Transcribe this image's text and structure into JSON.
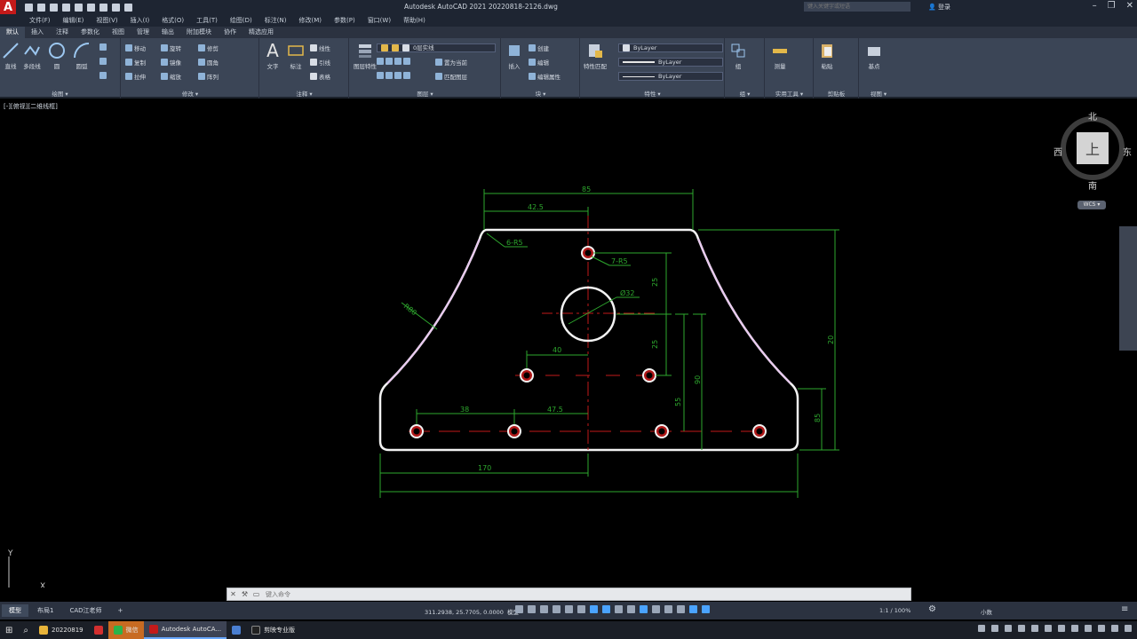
{
  "title_bar": {
    "logo": "A",
    "window_title": "Autodesk AutoCAD 2021    20220818-2126.dwg",
    "search_placeholder": "键入关键字或短语",
    "login": "登录"
  },
  "menu": [
    "文件(F)",
    "编辑(E)",
    "视图(V)",
    "插入(I)",
    "格式(O)",
    "工具(T)",
    "绘图(D)",
    "标注(N)",
    "修改(M)",
    "参数(P)",
    "窗口(W)",
    "帮助(H)"
  ],
  "ribbon_tabs": [
    "默认",
    "插入",
    "注释",
    "参数化",
    "视图",
    "管理",
    "输出",
    "附加模块",
    "协作",
    "精选应用"
  ],
  "active_tab": "默认",
  "ribbon": {
    "draw": {
      "label": "绘图 ▾",
      "line": "直线",
      "polyline": "多段线",
      "circle": "圆",
      "arc": "圆弧"
    },
    "modify": {
      "label": "修改 ▾",
      "move": "移动",
      "rotate": "旋转",
      "trim": "修剪",
      "copy": "复制",
      "mirror": "镜像",
      "fillet": "圆角",
      "stretch": "拉伸",
      "scale": "缩放",
      "array": "阵列"
    },
    "annotation": {
      "label": "注释 ▾",
      "text": "文字",
      "dimension": "标注",
      "linear": "线性",
      "leader": "引线",
      "table": "表格"
    },
    "layers": {
      "label": "图层 ▾",
      "layer_props": "图层特性",
      "current_layer": "0层实线",
      "make_current": "置为当前",
      "match_layer": "匹配图层"
    },
    "block": {
      "label": "块 ▾",
      "insert": "插入",
      "create": "创建",
      "edit": "编辑",
      "edit_attr": "编辑属性"
    },
    "properties": {
      "label": "特性 ▾",
      "match": "特性匹配",
      "color": "ByLayer",
      "linetype": "ByLayer",
      "lineweight": "ByLayer"
    },
    "groups": {
      "label": "组 ▾",
      "group": "组"
    },
    "utilities": {
      "label": "实用工具 ▾",
      "measure": "测量"
    },
    "clipboard": {
      "label": "剪贴板",
      "paste": "粘贴"
    },
    "view": {
      "label": "视图 ▾",
      "base": "基点"
    }
  },
  "viewport": {
    "label": "[-][俯视][二维线框]"
  },
  "viewcube": {
    "north": "北",
    "south": "南",
    "east": "东",
    "west": "西",
    "face": "上",
    "wcs": "WCS ▾"
  },
  "ucs": {
    "x": "X",
    "y": "Y"
  },
  "dimensions": [
    "85",
    "42.5",
    "6-R5",
    "7-R5",
    "R80",
    "Ø32",
    "25",
    "25",
    "40",
    "38",
    "47.5",
    "55",
    "90",
    "20",
    "85",
    "170"
  ],
  "command": {
    "placeholder": "键入命令"
  },
  "status": {
    "layout_tabs": [
      "模型",
      "布局1",
      "CAD江老师"
    ],
    "add_tab": "+",
    "coordinates": "311.2938, 25.7705, 0.0000",
    "model_label": "模型",
    "scale": "1:1 / 100%",
    "units": "小数"
  },
  "taskbar": {
    "items": [
      "20220819",
      "",
      "微信",
      "Autodesk AutoCA...",
      "",
      "剪映专业版"
    ],
    "time": ""
  }
}
